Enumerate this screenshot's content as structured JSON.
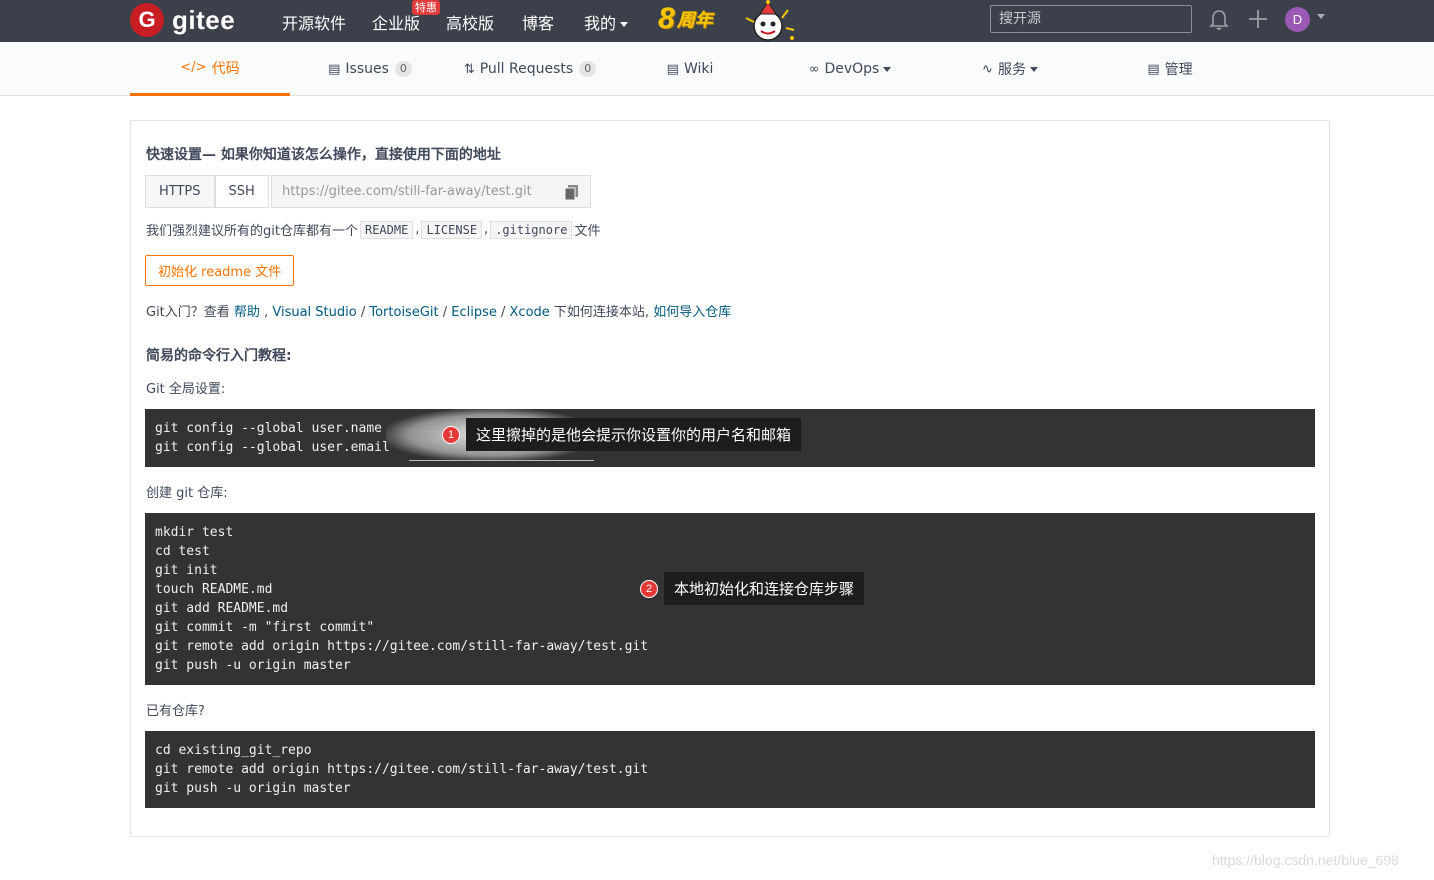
{
  "topnav": {
    "logo_text": "gitee",
    "logo_mark": "G",
    "links": [
      "开源软件",
      "企业版",
      "高校版",
      "博客",
      "我的"
    ],
    "hot_badge": "特惠",
    "anniversary_number": "8",
    "anniversary_text": "周年",
    "search_placeholder": "搜开源",
    "avatar_letter": "D"
  },
  "tabs": [
    {
      "icon": "code-icon",
      "label": "代码",
      "active": true
    },
    {
      "icon": "issues-icon",
      "label": "Issues",
      "count": "0"
    },
    {
      "icon": "pull-request-icon",
      "label": "Pull Requests",
      "count": "0"
    },
    {
      "icon": "wiki-icon",
      "label": "Wiki"
    },
    {
      "icon": "devops-icon",
      "label": "DevOps"
    },
    {
      "icon": "service-icon",
      "label": "服务"
    },
    {
      "icon": "manage-icon",
      "label": "管理"
    }
  ],
  "quick_setup": {
    "heading": "快速设置— 如果你知道该怎么操作，直接使用下面的地址",
    "protocols": [
      "HTTPS",
      "SSH"
    ],
    "url": "https://gitee.com/still-far-away/test.git",
    "recommend_prefix": "我们强烈建议所有的git仓库都有一个",
    "files": [
      "README",
      "LICENSE",
      ".gitignore"
    ],
    "recommend_suffix": "文件",
    "sep": ",",
    "init_button": "初始化 readme 文件",
    "intro_prefix": "Git入门？查看 ",
    "help_link": "帮助",
    "tool_links": [
      "Visual Studio",
      "TortoiseGit",
      "Eclipse",
      "Xcode"
    ],
    "intro_mid": " 下如何连接本站, ",
    "import_link": "如何导入仓库"
  },
  "tutorial": {
    "heading": "简易的命令行入门教程:",
    "global_label": "Git 全局设置:",
    "global_code": "git config --global user.name \ngit config --global user.email",
    "create_label": "创建 git 仓库:",
    "create_code": "mkdir test\ncd test\ngit init\ntouch README.md\ngit add README.md\ngit commit -m \"first commit\"\ngit remote add origin https://gitee.com/still-far-away/test.git\ngit push -u origin master",
    "existing_label": "已有仓库?",
    "existing_code": "cd existing_git_repo\ngit remote add origin https://gitee.com/still-far-away/test.git\ngit push -u origin master"
  },
  "annotations": [
    {
      "num": "1",
      "text": "这里擦掉的是他会提示你设置你的用户名和邮箱"
    },
    {
      "num": "2",
      "text": "本地初始化和连接仓库步骤"
    }
  ],
  "watermark": "https://blog.csdn.net/blue_698",
  "colors": {
    "accent": "#fe7300",
    "nav_bg": "#3b404a",
    "code_bg": "#333333",
    "link": "#005980"
  }
}
